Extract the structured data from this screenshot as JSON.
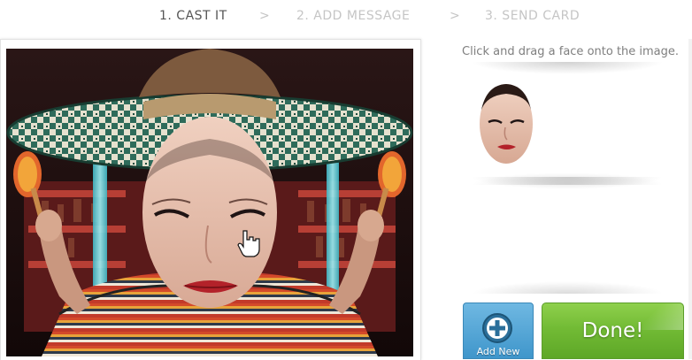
{
  "steps": [
    {
      "label": "1. CAST IT",
      "state": "active"
    },
    {
      "label": "2. ADD MESSAGE",
      "state": "inactive"
    },
    {
      "label": "3. SEND CARD",
      "state": "inactive"
    }
  ],
  "step_separator": ">",
  "panel": {
    "hint": "Click and drag a face onto the image.",
    "faces": [
      {
        "icon": "face-thumbnail"
      }
    ],
    "add_new_label": "Add New",
    "done_label": "Done!"
  },
  "stage": {
    "scene": "mariachi-card-template",
    "cursor": "hand-pointer"
  },
  "colors": {
    "active_step": "#555555",
    "inactive_step": "#c5c5c5",
    "add_button": "#4ea4d6",
    "done_button": "#72bb35"
  }
}
